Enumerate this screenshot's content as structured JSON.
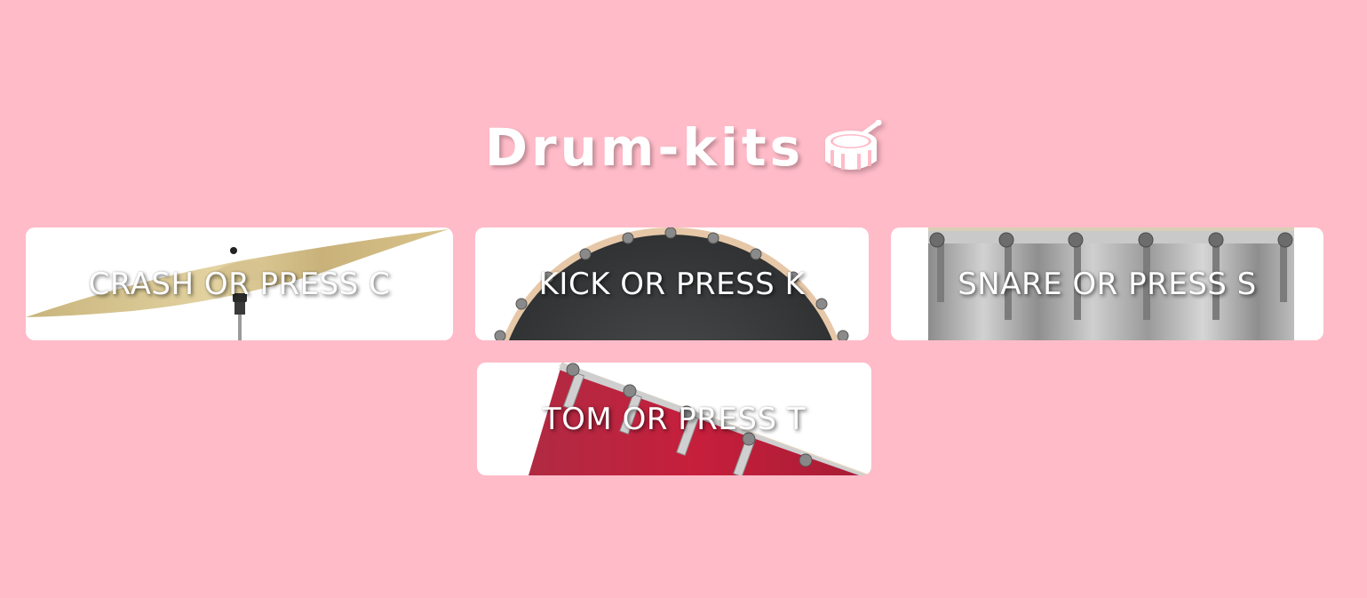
{
  "header": {
    "title": "Drum-kits",
    "icon": "drum-icon"
  },
  "pads": [
    {
      "id": "crash",
      "label": "CRASH OR PRESS C",
      "key": "C",
      "icon": "cymbal-image"
    },
    {
      "id": "kick",
      "label": "KICK OR PRESS K",
      "key": "K",
      "icon": "kick-drum-image"
    },
    {
      "id": "snare",
      "label": "SNARE OR PRESS S",
      "key": "S",
      "icon": "snare-drum-image"
    },
    {
      "id": "tom",
      "label": "TOM OR PRESS T",
      "key": "T",
      "icon": "tom-drum-image"
    }
  ],
  "colors": {
    "background": "#ffbbc8",
    "pad_background": "#ffffff",
    "text": "#ffffff"
  }
}
